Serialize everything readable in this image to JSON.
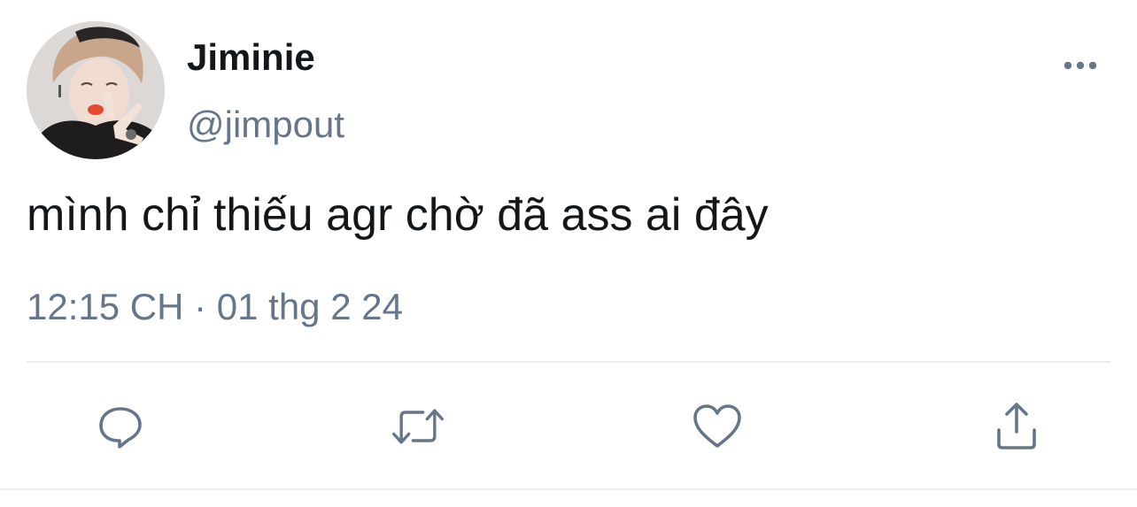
{
  "tweet": {
    "author": {
      "display_name": "Jiminie",
      "handle": "@jimpout",
      "avatar_icon": "profile-photo"
    },
    "text": "mình chỉ thiếu agr chờ đã ass ai đây",
    "timestamp": "12:15 CH · 01 thg 2 24",
    "more_icon": "more-horizontal-icon",
    "actions": [
      {
        "name": "reply",
        "icon": "reply-icon"
      },
      {
        "name": "retweet",
        "icon": "retweet-icon"
      },
      {
        "name": "like",
        "icon": "heart-icon"
      },
      {
        "name": "share",
        "icon": "share-icon"
      }
    ]
  },
  "colors": {
    "text": "#14171a",
    "secondary": "#66768a",
    "divider": "#e6ecf0"
  }
}
